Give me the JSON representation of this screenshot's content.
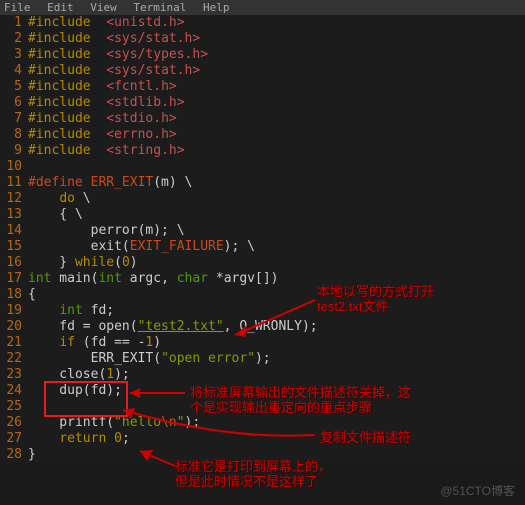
{
  "menu": {
    "items": [
      "File",
      "Edit",
      "View",
      "Terminal",
      "Help"
    ]
  },
  "code": {
    "lines": [
      {
        "n": 1,
        "parts": [
          [
            "kw",
            "#include"
          ],
          [
            "punc",
            "  "
          ],
          [
            "hdr",
            "<unistd.h>"
          ]
        ]
      },
      {
        "n": 2,
        "parts": [
          [
            "kw",
            "#include"
          ],
          [
            "punc",
            "  "
          ],
          [
            "hdr",
            "<sys/stat.h>"
          ]
        ]
      },
      {
        "n": 3,
        "parts": [
          [
            "kw",
            "#include"
          ],
          [
            "punc",
            "  "
          ],
          [
            "hdr",
            "<sys/types.h>"
          ]
        ]
      },
      {
        "n": 4,
        "parts": [
          [
            "kw",
            "#include"
          ],
          [
            "punc",
            "  "
          ],
          [
            "hdr",
            "<sys/stat.h>"
          ]
        ]
      },
      {
        "n": 5,
        "parts": [
          [
            "kw",
            "#include"
          ],
          [
            "punc",
            "  "
          ],
          [
            "hdr",
            "<fcntl.h>"
          ]
        ]
      },
      {
        "n": 6,
        "parts": [
          [
            "kw",
            "#include"
          ],
          [
            "punc",
            "  "
          ],
          [
            "hdr",
            "<stdlib.h>"
          ]
        ]
      },
      {
        "n": 7,
        "parts": [
          [
            "kw",
            "#include"
          ],
          [
            "punc",
            "  "
          ],
          [
            "hdr",
            "<stdio.h>"
          ]
        ]
      },
      {
        "n": 8,
        "parts": [
          [
            "kw",
            "#include"
          ],
          [
            "punc",
            "  "
          ],
          [
            "hdr",
            "<errno.h>"
          ]
        ]
      },
      {
        "n": 9,
        "parts": [
          [
            "kw",
            "#include"
          ],
          [
            "punc",
            "  "
          ],
          [
            "hdr",
            "<string.h>"
          ]
        ]
      },
      {
        "n": 10,
        "parts": []
      },
      {
        "n": 11,
        "parts": [
          [
            "pp",
            "#define ERR_EXIT"
          ],
          [
            "id",
            "(m) \\"
          ]
        ]
      },
      {
        "n": 12,
        "parts": [
          [
            "id",
            "    "
          ],
          [
            "kw",
            "do"
          ],
          [
            "id",
            " \\"
          ]
        ]
      },
      {
        "n": 13,
        "parts": [
          [
            "id",
            "    { \\"
          ]
        ]
      },
      {
        "n": 14,
        "parts": [
          [
            "id",
            "        perror(m); \\"
          ]
        ]
      },
      {
        "n": 15,
        "parts": [
          [
            "id",
            "        exit("
          ],
          [
            "pp",
            "EXIT_FAILURE"
          ],
          [
            "id",
            "); \\"
          ]
        ]
      },
      {
        "n": 16,
        "parts": [
          [
            "id",
            "    } "
          ],
          [
            "kw",
            "while"
          ],
          [
            "id",
            "("
          ],
          [
            "num",
            "0"
          ],
          [
            "id",
            ")"
          ]
        ]
      },
      {
        "n": 17,
        "parts": [
          [
            "typ",
            "int"
          ],
          [
            "id",
            " main("
          ],
          [
            "typ",
            "int"
          ],
          [
            "id",
            " argc, "
          ],
          [
            "typ",
            "char"
          ],
          [
            "id",
            " *argv[])"
          ]
        ]
      },
      {
        "n": 18,
        "parts": [
          [
            "id",
            "{"
          ]
        ]
      },
      {
        "n": 19,
        "parts": [
          [
            "id",
            "    "
          ],
          [
            "typ",
            "int"
          ],
          [
            "id",
            " fd;"
          ]
        ]
      },
      {
        "n": 20,
        "parts": [
          [
            "id",
            "    fd = open("
          ],
          [
            "str",
            "\"test2.txt\""
          ],
          [
            "id",
            ", O_WRONLY);"
          ]
        ]
      },
      {
        "n": 21,
        "parts": [
          [
            "id",
            "    "
          ],
          [
            "kw",
            "if"
          ],
          [
            "id",
            " (fd == -"
          ],
          [
            "num",
            "1"
          ],
          [
            "id",
            ")"
          ]
        ]
      },
      {
        "n": 22,
        "parts": [
          [
            "id",
            "        ERR_EXIT("
          ],
          [
            "strplain",
            "\"open error\""
          ],
          [
            "id",
            ");"
          ]
        ]
      },
      {
        "n": 23,
        "parts": [
          [
            "id",
            "    close("
          ],
          [
            "num",
            "1"
          ],
          [
            "id",
            ");"
          ]
        ]
      },
      {
        "n": 24,
        "parts": [
          [
            "id",
            "    dup(fd);"
          ]
        ]
      },
      {
        "n": 25,
        "parts": []
      },
      {
        "n": 26,
        "parts": [
          [
            "id",
            "    printf("
          ],
          [
            "strplain",
            "\"hello"
          ],
          [
            "pp",
            "\\n"
          ],
          [
            "strplain",
            "\""
          ],
          [
            "id",
            ");"
          ]
        ]
      },
      {
        "n": 27,
        "parts": [
          [
            "id",
            "    "
          ],
          [
            "kw",
            "return"
          ],
          [
            "id",
            " "
          ],
          [
            "num",
            "0"
          ],
          [
            "id",
            ";"
          ]
        ]
      },
      {
        "n": 28,
        "parts": [
          [
            "id",
            "}"
          ]
        ]
      }
    ]
  },
  "annotations": {
    "open_comment": "本地以写的方式打开\ntest2.txt文件",
    "close_comment": "将标准屏幕输出的文件描述符关掉，这\n个是实现输出重定向的重点步骤",
    "dup_comment": "复制文件描述符",
    "printf_comment": "标准它是打印到屏幕上的，\n但是此时情况不是这样了"
  },
  "watermark": "@51CTO博客"
}
